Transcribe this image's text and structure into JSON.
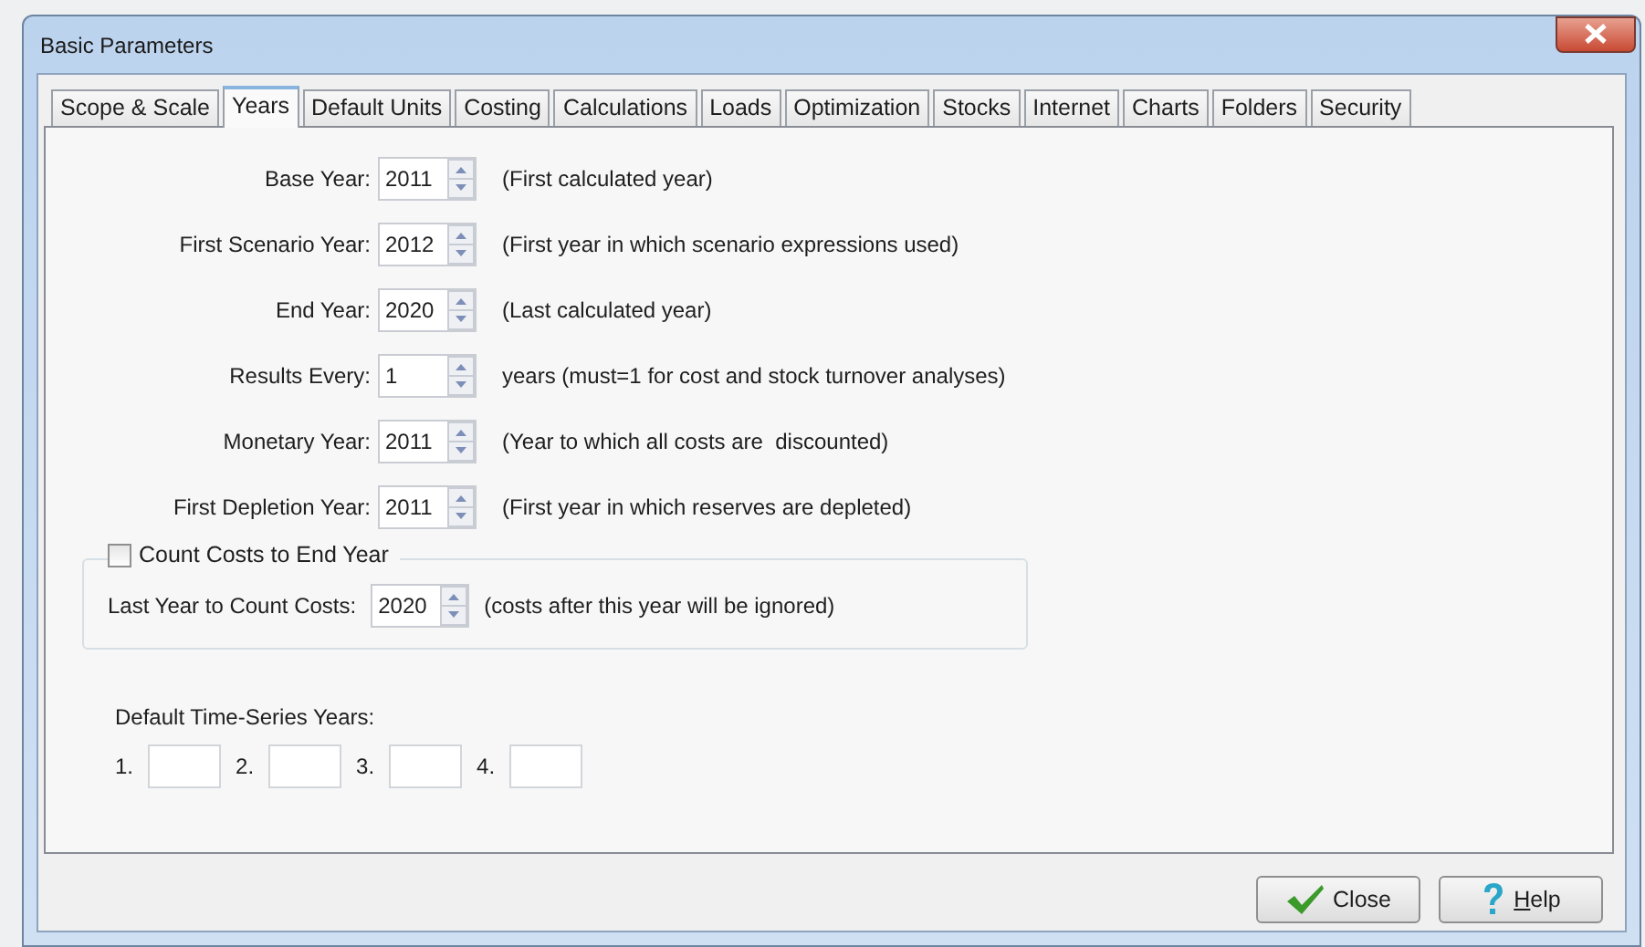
{
  "window": {
    "title": "Basic Parameters"
  },
  "tabs": [
    {
      "label": "Scope & Scale",
      "selected": false
    },
    {
      "label": "Years",
      "selected": true
    },
    {
      "label": "Default Units",
      "selected": false
    },
    {
      "label": "Costing",
      "selected": false
    },
    {
      "label": "Calculations",
      "selected": false
    },
    {
      "label": "Loads",
      "selected": false
    },
    {
      "label": "Optimization",
      "selected": false
    },
    {
      "label": "Stocks",
      "selected": false
    },
    {
      "label": "Internet",
      "selected": false
    },
    {
      "label": "Charts",
      "selected": false
    },
    {
      "label": "Folders",
      "selected": false
    },
    {
      "label": "Security",
      "selected": false
    }
  ],
  "year_fields": [
    {
      "label": "Base Year:",
      "value": "2011",
      "note": "(First calculated year)"
    },
    {
      "label": "First Scenario Year:",
      "value": "2012",
      "note": "(First year in which scenario expressions used)"
    },
    {
      "label": "End Year:",
      "value": "2020",
      "note": "(Last calculated year)"
    },
    {
      "label": "Results Every:",
      "value": "1",
      "note": "years (must=1 for cost and stock turnover analyses)"
    },
    {
      "label": "Monetary Year:",
      "value": "2011",
      "note": "(Year to which all costs are  discounted)"
    },
    {
      "label": "First Depletion Year:",
      "value": "2011",
      "note": "(First year in which reserves are depleted)"
    }
  ],
  "count_costs": {
    "label": "Count Costs to End Year",
    "checked": false,
    "field": {
      "label": "Last Year to Count Costs:",
      "value": "2020",
      "note": "(costs after this year will be ignored)"
    }
  },
  "time_series": {
    "label": "Default Time-Series Years:",
    "fields": [
      {
        "label": "1."
      },
      {
        "label": "2."
      },
      {
        "label": "3."
      },
      {
        "label": "4."
      }
    ]
  },
  "buttons": [
    {
      "label": "Close",
      "kind": "close"
    },
    {
      "label": "Help",
      "kind": "help"
    }
  ]
}
